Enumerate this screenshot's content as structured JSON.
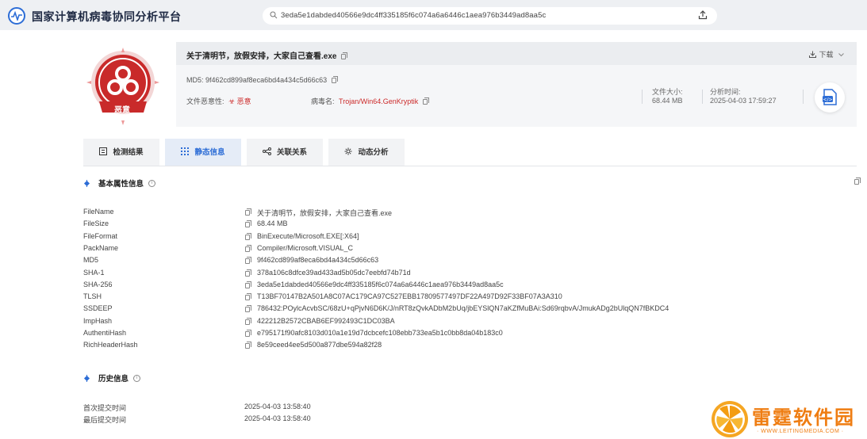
{
  "header": {
    "title": "国家计算机病毒协同分析平台",
    "search_value": "3eda5e1dabded40566e9dc4ff335185f6c074a6a6446c1aea976b3449ad8aa5c"
  },
  "summary": {
    "badge_label": "恶意",
    "file_name": "关于清明节，放假安排，大家自己查看.exe",
    "download_label": "下载",
    "md5_text": "MD5:  9f462cd899af8eca6bd4a434c5d66c63",
    "maliciousness_label": "文件恶意性:",
    "maliciousness_value": "恶意",
    "virus_label": "病毒名:",
    "virus_value": "Trojan/Win64.GenKryptik",
    "size_label": "文件大小:",
    "size_value": "68.44 MB",
    "time_label": "分析时间:",
    "time_value": "2025-04-03 17:59:27",
    "accent_color": "#cc2a2a"
  },
  "tabs": [
    {
      "label": "检测结果",
      "icon": "list-icon"
    },
    {
      "label": "静态信息",
      "icon": "grid-icon"
    },
    {
      "label": "关联关系",
      "icon": "share-icon"
    },
    {
      "label": "动态分析",
      "icon": "gear-icon"
    }
  ],
  "sections": {
    "basic_title": "基本属性信息",
    "history_title": "历史信息"
  },
  "properties": [
    {
      "key": "FileName",
      "value": "关于清明节，放假安排，大家自己查看.exe"
    },
    {
      "key": "FileSize",
      "value": "68.44 MB"
    },
    {
      "key": "FileFormat",
      "value": "BinExecute/Microsoft.EXE[:X64]"
    },
    {
      "key": "PackName",
      "value": "Compiler/Microsoft.VISUAL_C"
    },
    {
      "key": "MD5",
      "value": "9f462cd899af8eca6bd4a434c5d66c63"
    },
    {
      "key": "SHA-1",
      "value": "378a106c8dfce39ad433ad5b05dc7eebfd74b71d"
    },
    {
      "key": "SHA-256",
      "value": "3eda5e1dabded40566e9dc4ff335185f6c074a6a6446c1aea976b3449ad8aa5c"
    },
    {
      "key": "TLSH",
      "value": "T13BF70147B2A501A8C07AC179CA97C527EBB17809577497DF22A497D92F33BF07A3A310"
    },
    {
      "key": "SSDEEP",
      "value": "786432:POylcAcvbSC/68zU+qPjvN6D6K/J/nRT8zQvkADbM2bUq/jbEYSlQN7aKZfMuBAi:Sd69rqbvA/JmukADg2bUlqQN7fBKDC4"
    },
    {
      "key": "ImpHash",
      "value": "422212B2572CBAB6EF992493C1DC03BA"
    },
    {
      "key": "AuthentiHash",
      "value": "e795171f90afc8103d010a1e19d7dcbcefc108ebb733ea5b1c0bb8da04b183c0"
    },
    {
      "key": "RichHeaderHash",
      "value": "8e59ceed4ee5d500a877dbe594a82f28"
    }
  ],
  "history": [
    {
      "key": "首次提交时间",
      "value": "2025-04-03 13:58:40"
    },
    {
      "key": "最后提交时间",
      "value": "2025-04-03 13:58:40"
    }
  ],
  "watermark": {
    "title": "雷霆软件园",
    "url": "· WWW.LEITINGMEDIA.COM ·"
  }
}
